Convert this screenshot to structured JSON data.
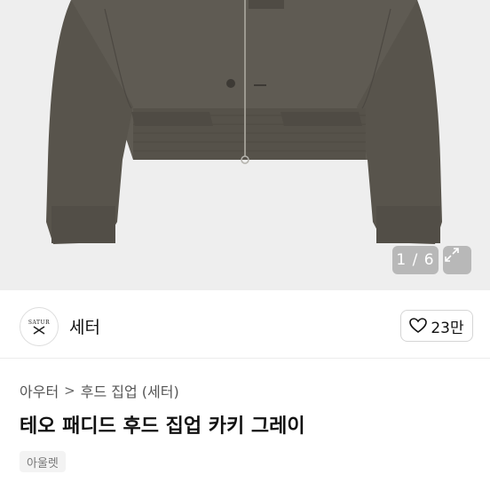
{
  "gallery": {
    "counter": "1 / 6",
    "image_subject": "jacket-photo"
  },
  "shop": {
    "avatar_text": "SATUR",
    "name": "세터",
    "likes": "23만"
  },
  "breadcrumb": {
    "level1": "아우터",
    "separator": ">",
    "level2": "후드 집업 (세터)"
  },
  "product": {
    "title": "테오 패디드 후드 집업 카키 그레이",
    "tag": "아울렛"
  },
  "colors": {
    "jacket": "#5f5b53",
    "background": "#eeeeee"
  }
}
